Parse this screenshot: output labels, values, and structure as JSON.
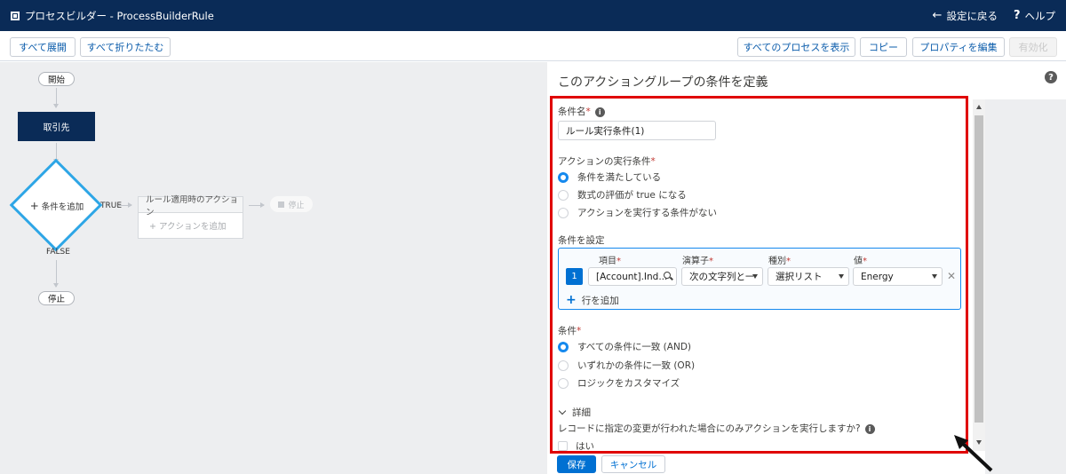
{
  "header": {
    "title": "プロセスビルダー - ProcessBuilderRule",
    "back_label": "設定に戻る",
    "help_label": "ヘルプ"
  },
  "toolbar": {
    "expand_all": "すべて展開",
    "collapse_all": "すべて折りたたむ",
    "view_all_processes": "すべてのプロセスを表示",
    "copy": "コピー",
    "edit_properties": "プロパティを編集",
    "activate": "有効化"
  },
  "canvas": {
    "start": "開始",
    "object_node": "取引先",
    "add_criteria": "条件を追加",
    "true_label": "TRUE",
    "false_label": "FALSE",
    "action_group_title": "ルール適用時のアクション",
    "add_action": "アクションを追加",
    "stop_right": "停止",
    "stop_bottom": "停止"
  },
  "panel": {
    "title": "このアクショングループの条件を定義",
    "criteria_name_label": "条件名",
    "criteria_name_value": "ルール実行条件(1)",
    "criteria_for_executing_label": "アクションの実行条件",
    "criteria_options": [
      {
        "label": "条件を満たしている",
        "selected": true
      },
      {
        "label": "数式の評価が true になる",
        "selected": false
      },
      {
        "label": "アクションを実行する条件がない",
        "selected": false
      }
    ],
    "set_conditions_label": "条件を設定",
    "condition_columns": {
      "field": "項目",
      "operator": "演算子",
      "type": "種別",
      "value": "値"
    },
    "condition_row": {
      "number": "1",
      "field": "[Account].Ind...",
      "operator": "次の文字列と一致する",
      "type": "選択リスト",
      "value": "Energy"
    },
    "add_row": "行を追加",
    "conditions_label": "条件",
    "logic_options": [
      {
        "label": "すべての条件に一致 (AND)",
        "selected": true
      },
      {
        "label": "いずれかの条件に一致 (OR)",
        "selected": false
      },
      {
        "label": "ロジックをカスタマイズ",
        "selected": false
      }
    ],
    "advanced_label": "詳細",
    "advanced_question": "レコードに指定の変更が行われた場合にのみアクションを実行しますか?",
    "yes_label": "はい",
    "save": "保存",
    "cancel": "キャンセル"
  },
  "colors": {
    "header_bg": "#0a2b57",
    "accent": "#0070d2",
    "diamond_border": "#2ea6e6",
    "highlight_frame": "#e00000"
  }
}
